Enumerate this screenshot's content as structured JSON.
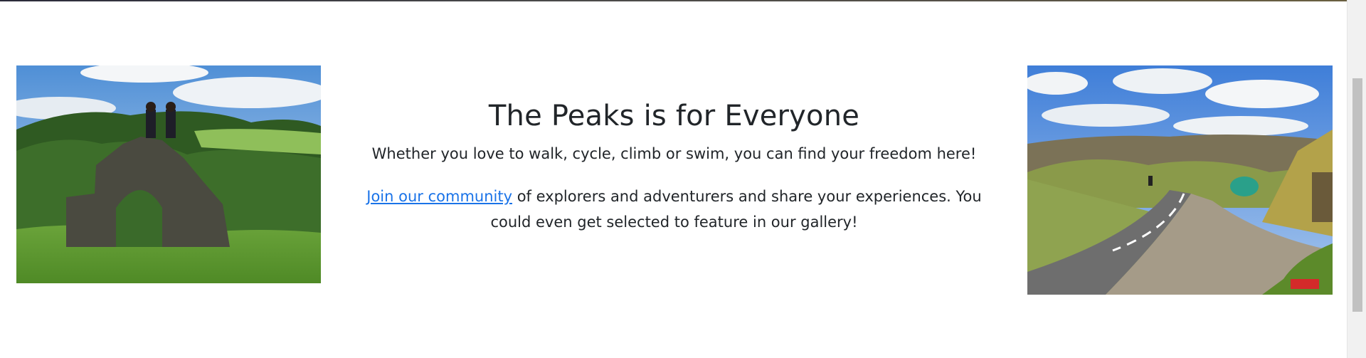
{
  "section": {
    "title": "The Peaks is for Everyone",
    "tagline": "Whether you love to walk, cycle, climb or swim, you can find your freedom here!",
    "community_link": "Join our community",
    "community_text": " of explorers and adventurers and share your experiences. You could even get selected to feature in our gallery!"
  },
  "images": {
    "left": {
      "subject": "two people sitting atop a ruined stone arch on a green hillside"
    },
    "right": {
      "subject": "cyclist on a winding moorland road through a valley"
    }
  },
  "colors": {
    "link": "#1a73e8",
    "text": "#212529",
    "background": "#ffffff"
  }
}
